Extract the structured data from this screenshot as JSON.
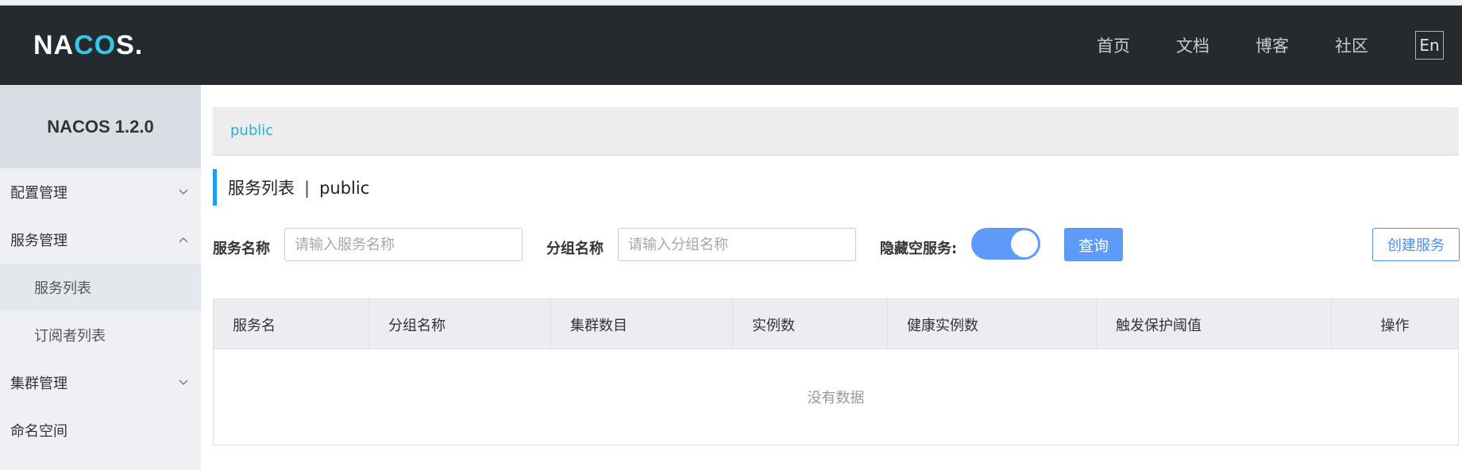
{
  "header": {
    "logo": {
      "part1": "NA",
      "part2": "CO",
      "part3": "S."
    },
    "nav": [
      "首页",
      "文档",
      "博客",
      "社区"
    ],
    "lang_button": "En"
  },
  "sidebar": {
    "title": "NACOS 1.2.0",
    "items": [
      {
        "label": "配置管理",
        "type": "group",
        "expanded": false
      },
      {
        "label": "服务管理",
        "type": "group",
        "expanded": true
      },
      {
        "label": "服务列表",
        "type": "subitem",
        "active": true
      },
      {
        "label": "订阅者列表",
        "type": "subitem",
        "active": false
      },
      {
        "label": "集群管理",
        "type": "group",
        "expanded": false
      },
      {
        "label": "命名空间",
        "type": "item"
      }
    ]
  },
  "breadcrumb": {
    "namespace": "public"
  },
  "page": {
    "title": "服务列表",
    "separator": "|",
    "namespace": "public"
  },
  "filters": {
    "service_name_label": "服务名称",
    "service_name_placeholder": "请输入服务名称",
    "group_name_label": "分组名称",
    "group_name_placeholder": "请输入分组名称",
    "hide_empty_label": "隐藏空服务:",
    "hide_empty_on": true,
    "query_button": "查询",
    "create_button": "创建服务"
  },
  "table": {
    "columns": [
      "服务名",
      "分组名称",
      "集群数目",
      "实例数",
      "健康实例数",
      "触发保护阈值",
      "操作"
    ],
    "rows": [],
    "empty_text": "没有数据"
  },
  "colors": {
    "header_bg": "#252a2f",
    "accent": "#5e9bf8",
    "link": "#1fb6d6"
  }
}
